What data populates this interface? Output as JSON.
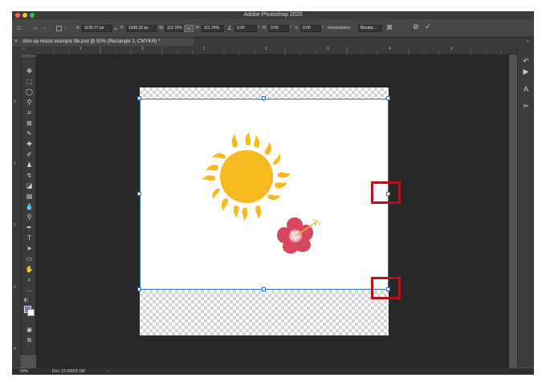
{
  "window": {
    "title": "Adobe Photoshop 2020",
    "traffic_colors": [
      "#fc5f57",
      "#fdbc2e",
      "#28c840"
    ]
  },
  "options_bar": {
    "x_label": "X:",
    "x_value": "1195.77 px",
    "y_label": "Y:",
    "y_value": "1036.32 px",
    "w_label": "W:",
    "w_value": "111.76%",
    "h_label": "H:",
    "h_value": "111.76%",
    "angle_value": "0.00",
    "angle_unit": "°",
    "hskew_label": "H:",
    "hskew_value": "0.00",
    "vskew_label": "V:",
    "vskew_value": "0.00",
    "interp_label": "Interpolation:",
    "interp_value": "Bicubic..."
  },
  "document_tab": {
    "close_glyph": "×",
    "label": "click up resize example file.psd @ 50% (Rectangle 1, CMYK/8) *"
  },
  "ruler_top_labels": [
    "1",
    "0",
    "1",
    "2",
    "3",
    "4",
    "5"
  ],
  "ruler_left_labels": [
    "0",
    "1",
    "2",
    "3",
    "4"
  ],
  "status": {
    "zoom": "50%",
    "doc": "Doc: 22.0M/25.0M",
    "arrow": "›"
  },
  "icons": {
    "home": "home-icon",
    "move": "move-icon",
    "marquee": "marquee-icon",
    "lasso": "lasso-icon",
    "crop": "crop-icon",
    "eyedropper": "eyedropper-icon",
    "brush": "brush-icon",
    "type": "type-icon",
    "hand": "hand-icon",
    "zoom": "zoom-icon",
    "cancel": "cancel-icon",
    "commit": "commit-icon",
    "warp": "warp-icon"
  },
  "colors": {
    "sun": "#f6b91f",
    "flower": "#d8455f",
    "highlight": "#b3141c",
    "selection": "#2a73c9",
    "foreground": "#8e6fb5",
    "background": "#ffffff"
  }
}
